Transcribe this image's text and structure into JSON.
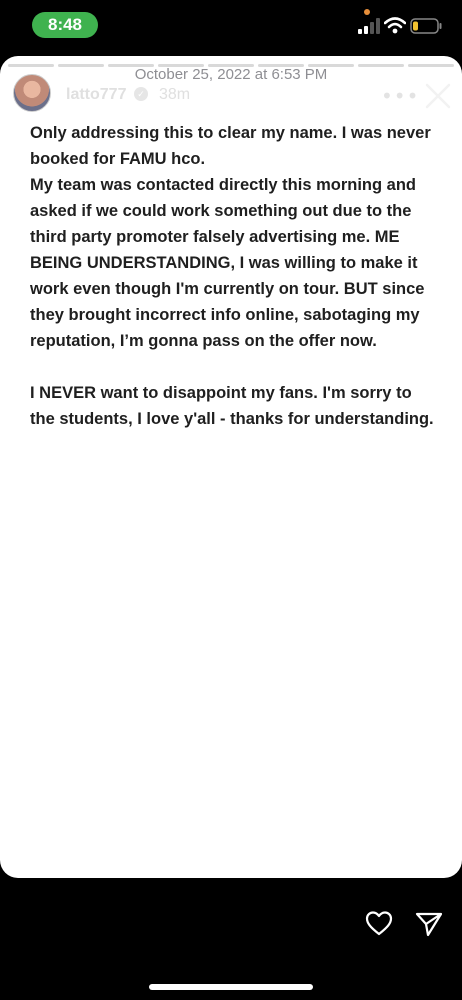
{
  "status_bar": {
    "time": "8:48"
  },
  "story": {
    "date": "October 25, 2022 at 6:53 PM",
    "username": "latto777",
    "time_ago": "38m",
    "more_label": "•••",
    "paragraphs": [
      "Only addressing this to clear my name. I was never booked for FAMU hco.\nMy team was contacted directly this morning and asked if we could work something out due to the third party promoter falsely advertising me. ME BEING UNDERSTANDING, I was willing to make it work even though I'm currently on tour. BUT since they brought incorrect info online, sabotaging my reputation, I’m gonna pass on the offer now.",
      "I NEVER want to disappoint my fans. I'm sorry to the students, I love y'all - thanks for understanding."
    ]
  },
  "icons": {
    "close": "close-icon",
    "heart": "heart-icon",
    "send": "send-icon",
    "verified": "verified-badge-icon"
  }
}
